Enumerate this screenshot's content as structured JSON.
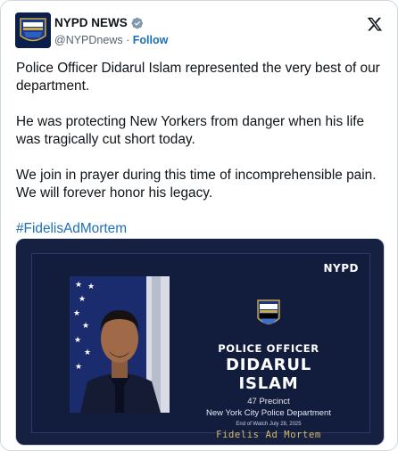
{
  "author": {
    "display_name": "NYPD NEWS",
    "handle": "@NYPDnews",
    "separator": "·",
    "follow_label": "Follow",
    "verified_color": "#829aab",
    "avatar_icon": "nypd-patch-icon"
  },
  "platform_icon": "x-logo-icon",
  "tweet": {
    "paragraphs": [
      "Police Officer Didarul Islam represented the very best of our department.",
      "He was protecting New Yorkers from danger when his life was tragically cut short today.",
      "We join in prayer during this time of incomprehensible pain. We will forever honor his legacy."
    ],
    "hashtag": "#FidelisAdMortem"
  },
  "media": {
    "corner_label": "NYPD",
    "badge_icon": "police-department-badge-icon",
    "rank": "POLICE OFFICER",
    "name": "DIDARUL ISLAM",
    "precinct": "47 Precinct",
    "department": "New York City Police Department",
    "end_of_watch": "End of Watch July 28, 2025",
    "motto": "Fidelis Ad Mortem"
  },
  "colors": {
    "link": "#1d6fb5",
    "media_bg": "#121d3d",
    "motto": "#d9b867"
  }
}
